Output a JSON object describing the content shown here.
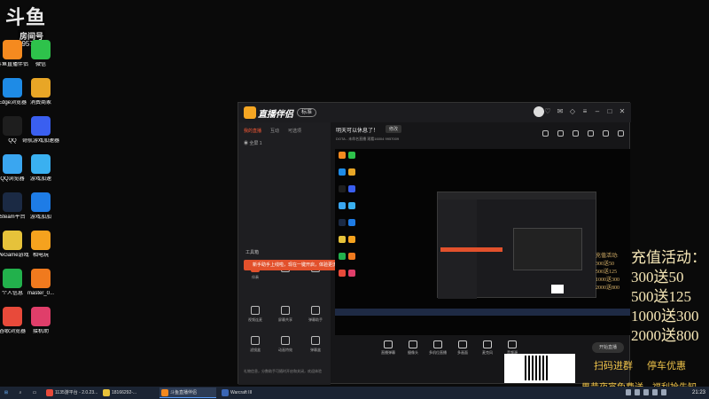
{
  "watermark": {
    "logo_text": "斗鱼",
    "room_label": "房间号",
    "room_number": "9957009"
  },
  "desktop_icons": [
    {
      "label": "斗鱼直播伴侣",
      "color": "#f58a1f"
    },
    {
      "label": "微信",
      "color": "#2ec24b"
    },
    {
      "label": "Edge浏览器",
      "color": "#1e8be6"
    },
    {
      "label": "消费商家",
      "color": "#e8a626"
    },
    {
      "label": "QQ",
      "color": "#1e1e1e"
    },
    {
      "label": "奇航游戏加速器",
      "color": "#3a5ff0"
    },
    {
      "label": "QQ浏览器",
      "color": "#3aa6f0"
    },
    {
      "label": "游戏加速",
      "color": "#3ab0f0"
    },
    {
      "label": "Steam平台",
      "color": "#1b2a44"
    },
    {
      "label": "游戏加加",
      "color": "#1e7ce6"
    },
    {
      "label": "WeGame游戏",
      "color": "#e6c23a"
    },
    {
      "label": "相电玩",
      "color": "#f5a21e"
    },
    {
      "label": "个人信息",
      "color": "#22b14c"
    },
    {
      "label": "master_0...",
      "color": "#f07a1e"
    },
    {
      "label": "谷歌浏览器",
      "color": "#e84a3a"
    },
    {
      "label": "接机助",
      "color": "#e03e6a"
    }
  ],
  "app": {
    "name": "直播伴侣",
    "version_badge": "标准",
    "left_tabs": [
      "我的直播",
      "互动",
      "可选项"
    ],
    "scene_label": "全屏 1",
    "tools_title": "工具箱",
    "tools": [
      "伴奏",
      "",
      "",
      "视频连麦",
      "屏幕共享",
      "弹幕助手",
      "滤镜盒",
      "动画特效",
      "弹幕盒"
    ],
    "notice": "新手助手上线啦，现在一键开启，体验更流畅的直播！",
    "footer": "礼物信息，分数助手可随时开启和关闭，欢迎体验",
    "stream_title": "明天可以休息了！",
    "modify_button": "修改",
    "subtitle": "DOTA - 未命名直播   观看16004   9957009",
    "bottom_buttons": [
      "直播弹幕",
      "摄像头",
      "多机位直播",
      "多画面",
      "麦克风",
      "音频源"
    ],
    "go_live": "开始直播"
  },
  "promo": {
    "title": "充值活动：",
    "lines": [
      "300送50",
      "500送125",
      "1000送300",
      "2000送800"
    ],
    "small_lines": [
      "充值活动:",
      "300送50",
      "500送125",
      "1000送300",
      "2000送800"
    ],
    "scan_label": "扫码进群",
    "parking_label": "停车优惠",
    "bottom_text": "果昔夜宵免费送，福利抢先知"
  },
  "taskbar": {
    "items": [
      {
        "label": "1135游平台 - 2.0.23...",
        "color": "#e84a3a"
      },
      {
        "label": "18166292-...",
        "color": "#e8c23a"
      },
      {
        "label": "斗鱼直播伴侣",
        "color": "#f58a1f"
      },
      {
        "label": "Warcraft III",
        "color": "#3a66b5"
      }
    ],
    "clock": "21:23"
  }
}
